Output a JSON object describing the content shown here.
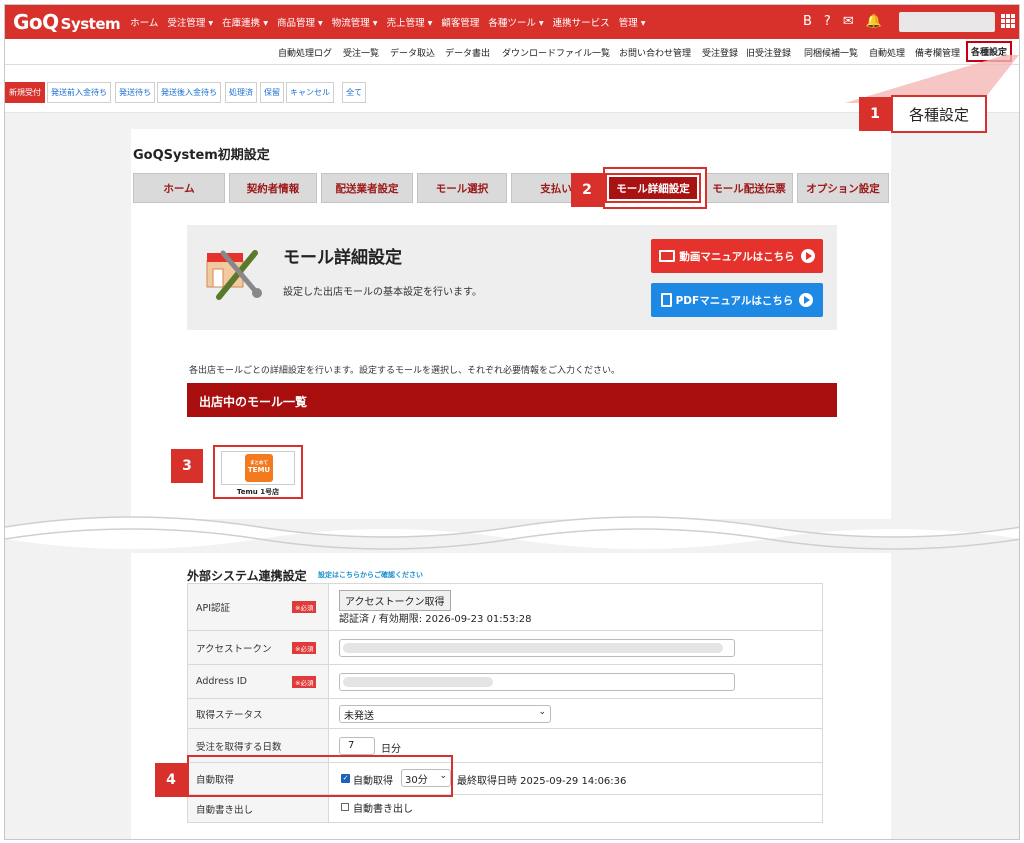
{
  "topbar": {
    "logo": "GoQ",
    "logo_sub": "System",
    "nav": [
      "ホーム",
      "受注管理 ▾",
      "在庫連携 ▾",
      "商品管理 ▾",
      "物流管理 ▾",
      "売上管理 ▾",
      "顧客管理",
      "各種ツール ▾",
      "連携サービス",
      "管理 ▾"
    ],
    "icons": [
      "B",
      "?",
      "✉",
      "🔔"
    ]
  },
  "subnav": [
    "自動処理ログ",
    "受注一覧",
    "データ取込",
    "データ書出",
    "ダウンロードファイル一覧",
    "お問い合わせ管理",
    "受注登録",
    "旧受注登録",
    "同梱候補一覧",
    "自動処理",
    "備考欄管理",
    "各種設定"
  ],
  "statusTabs": [
    "新規受付",
    "発送前入金待ち",
    "発送待ち",
    "発送後入金待ち",
    "処理済",
    "保留",
    "キャンセル",
    "全て"
  ],
  "page": {
    "title": "GoQSystem初期設定",
    "tabs": [
      "ホーム",
      "契約者情報",
      "配送業者設定",
      "モール選択",
      "支払い",
      "モール詳細設定",
      "モール配送伝票",
      "オプション設定"
    ]
  },
  "hero": {
    "title": "モール詳細設定",
    "desc": "設定した出店モールの基本設定を行います。",
    "video_btn": "動画マニュアルはこちら",
    "pdf_btn": "PDFマニュアルはこちら"
  },
  "intro": "各出店モールごとの詳細設定を行います。設定するモールを選択し、それぞれ必要情報をご入力ください。",
  "mallList": {
    "header": "出店中のモール一覧",
    "logo_top": "まとめて",
    "logo_text": "TEMU",
    "name": "Temu 1号店"
  },
  "ext": {
    "title": "外部システム連携設定",
    "link": "設定はこちらからご確認ください",
    "required": "※必須",
    "rows": {
      "api_label": "API認証",
      "api_btn": "アクセストークン取得",
      "api_status": "認証済 / 有効期限: 2026-09-23 01:53:28",
      "token_label": "アクセストークン",
      "address_label": "Address ID",
      "status_label": "取得ステータス",
      "status_value": "未発送",
      "days_label": "受注を取得する日数",
      "days_value": "7",
      "days_unit": "日分",
      "auto_label": "自動取得",
      "auto_check": "自動取得",
      "auto_interval": "30分",
      "auto_last": "最終取得日時 2025-09-29 14:06:36",
      "export_label": "自動書き出し",
      "export_check": "自動書き出し"
    }
  },
  "callouts": {
    "c1": "1",
    "c1_label": "各種設定",
    "c2": "2",
    "c3": "3",
    "c4": "4"
  },
  "colors": {
    "brand": "#d8312c",
    "dark_red": "#a80e0e",
    "blue": "#1e88e5"
  }
}
